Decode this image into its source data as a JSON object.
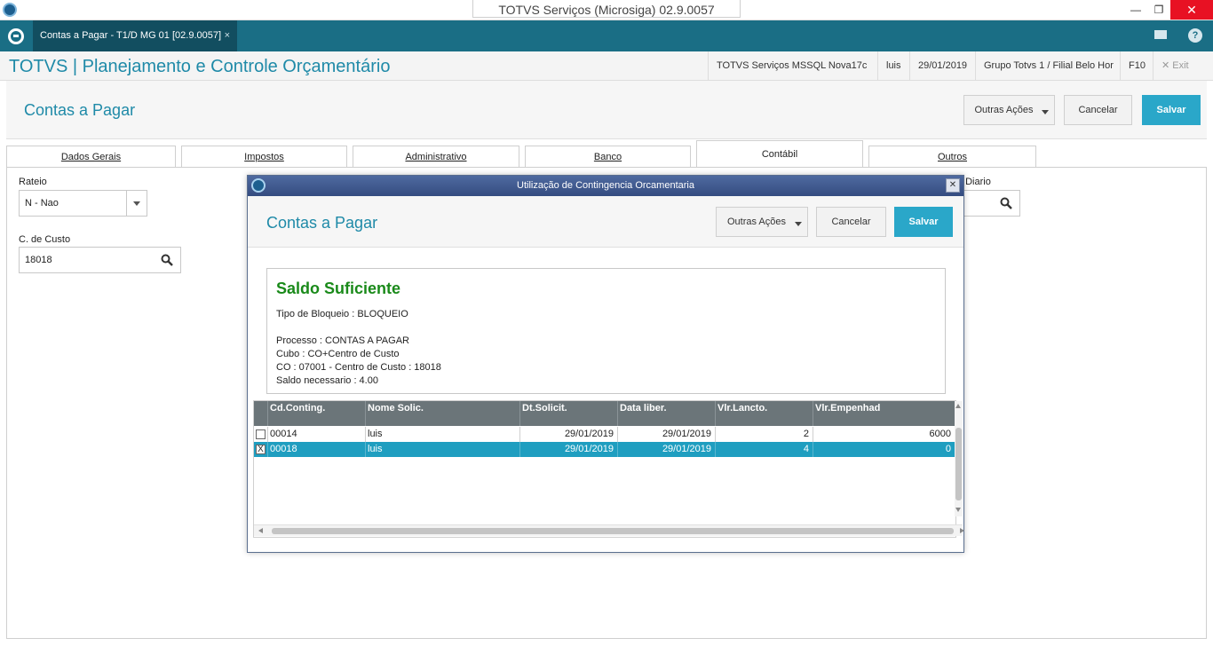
{
  "window": {
    "title": "TOTVS Serviços (Microsiga) 02.9.0057"
  },
  "tabbar": {
    "doc_tab": "Contas a Pagar - T1/D MG 01  [02.9.0057]",
    "close": "×"
  },
  "appheader": {
    "brand": "TOTVS | Planejamento e Controle Orçamentário",
    "server": "TOTVS Serviços MSSQL Nova17c",
    "user": "luis",
    "date": "29/01/2019",
    "branch": "Grupo Totvs 1 / Filial Belo Hor",
    "shortcut": "F10",
    "exit": "Exit"
  },
  "page": {
    "title": "Contas a Pagar",
    "buttons": {
      "more": "Outras Ações",
      "cancel": "Cancelar",
      "save": "Salvar"
    }
  },
  "tabs": [
    "Dados Gerais",
    "Impostos",
    "Administrativo",
    "Banco",
    "Contábil",
    "Outros"
  ],
  "form": {
    "rateio_label": "Rateio",
    "rateio_value": "N - Nao",
    "custo_label": "C. de Custo",
    "custo_value": "18018",
    "diario_label": ". Diario"
  },
  "modal": {
    "title": "Utilização de Contingencia Orcamentaria",
    "header": "Contas a Pagar",
    "buttons": {
      "more": "Outras Ações",
      "cancel": "Cancelar",
      "save": "Salvar"
    },
    "message": {
      "status": "Saldo Suficiente",
      "bloqueio": "Tipo de Bloqueio : BLOQUEIO",
      "processo": "Processo : CONTAS A PAGAR",
      "cubo": "Cubo : CO+Centro de Custo",
      "co": "CO : 07001 - Centro de Custo : 18018",
      "saldo": "Saldo necessario : 4.00"
    },
    "grid": {
      "columns": [
        "Cd.Conting.",
        "Nome Solic.",
        "Dt.Solicit.",
        "Data liber.",
        "Vlr.Lancto.",
        "Vlr.Empenhad"
      ],
      "rows": [
        {
          "checked": "",
          "cd": "00014",
          "nome": "luis",
          "dt": "29/01/2019",
          "lib": "29/01/2019",
          "lancto": "2",
          "empenhad": "6000"
        },
        {
          "checked": "X",
          "cd": "00018",
          "nome": "luis",
          "dt": "29/01/2019",
          "lib": "29/01/2019",
          "lancto": "4",
          "empenhad": "0"
        }
      ]
    }
  },
  "colors": {
    "teal": "#1a6e85",
    "accent": "#2aa7c9",
    "title": "#1f8aa8",
    "ok_green": "#1a8a1a",
    "selected_row": "#1f9ec0"
  }
}
